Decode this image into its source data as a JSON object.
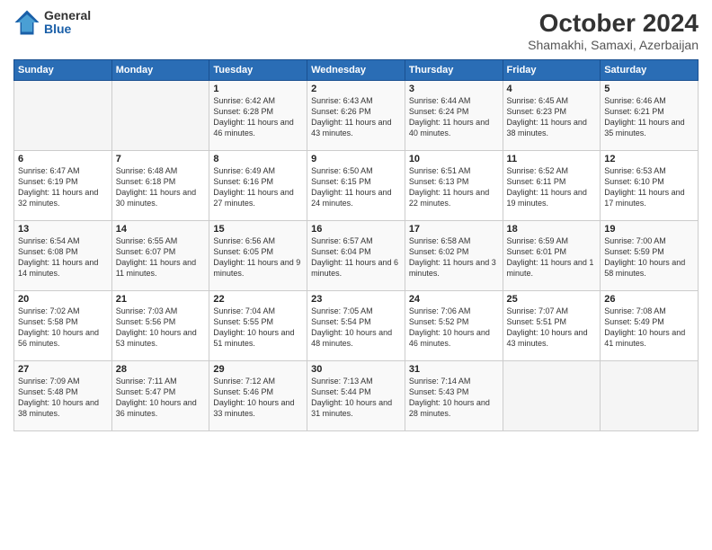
{
  "logo": {
    "general": "General",
    "blue": "Blue"
  },
  "header": {
    "month": "October 2024",
    "location": "Shamakhi, Samaxi, Azerbaijan"
  },
  "weekdays": [
    "Sunday",
    "Monday",
    "Tuesday",
    "Wednesday",
    "Thursday",
    "Friday",
    "Saturday"
  ],
  "weeks": [
    [
      {
        "day": "",
        "content": ""
      },
      {
        "day": "",
        "content": ""
      },
      {
        "day": "1",
        "content": "Sunrise: 6:42 AM\nSunset: 6:28 PM\nDaylight: 11 hours and 46 minutes."
      },
      {
        "day": "2",
        "content": "Sunrise: 6:43 AM\nSunset: 6:26 PM\nDaylight: 11 hours and 43 minutes."
      },
      {
        "day": "3",
        "content": "Sunrise: 6:44 AM\nSunset: 6:24 PM\nDaylight: 11 hours and 40 minutes."
      },
      {
        "day": "4",
        "content": "Sunrise: 6:45 AM\nSunset: 6:23 PM\nDaylight: 11 hours and 38 minutes."
      },
      {
        "day": "5",
        "content": "Sunrise: 6:46 AM\nSunset: 6:21 PM\nDaylight: 11 hours and 35 minutes."
      }
    ],
    [
      {
        "day": "6",
        "content": "Sunrise: 6:47 AM\nSunset: 6:19 PM\nDaylight: 11 hours and 32 minutes."
      },
      {
        "day": "7",
        "content": "Sunrise: 6:48 AM\nSunset: 6:18 PM\nDaylight: 11 hours and 30 minutes."
      },
      {
        "day": "8",
        "content": "Sunrise: 6:49 AM\nSunset: 6:16 PM\nDaylight: 11 hours and 27 minutes."
      },
      {
        "day": "9",
        "content": "Sunrise: 6:50 AM\nSunset: 6:15 PM\nDaylight: 11 hours and 24 minutes."
      },
      {
        "day": "10",
        "content": "Sunrise: 6:51 AM\nSunset: 6:13 PM\nDaylight: 11 hours and 22 minutes."
      },
      {
        "day": "11",
        "content": "Sunrise: 6:52 AM\nSunset: 6:11 PM\nDaylight: 11 hours and 19 minutes."
      },
      {
        "day": "12",
        "content": "Sunrise: 6:53 AM\nSunset: 6:10 PM\nDaylight: 11 hours and 17 minutes."
      }
    ],
    [
      {
        "day": "13",
        "content": "Sunrise: 6:54 AM\nSunset: 6:08 PM\nDaylight: 11 hours and 14 minutes."
      },
      {
        "day": "14",
        "content": "Sunrise: 6:55 AM\nSunset: 6:07 PM\nDaylight: 11 hours and 11 minutes."
      },
      {
        "day": "15",
        "content": "Sunrise: 6:56 AM\nSunset: 6:05 PM\nDaylight: 11 hours and 9 minutes."
      },
      {
        "day": "16",
        "content": "Sunrise: 6:57 AM\nSunset: 6:04 PM\nDaylight: 11 hours and 6 minutes."
      },
      {
        "day": "17",
        "content": "Sunrise: 6:58 AM\nSunset: 6:02 PM\nDaylight: 11 hours and 3 minutes."
      },
      {
        "day": "18",
        "content": "Sunrise: 6:59 AM\nSunset: 6:01 PM\nDaylight: 11 hours and 1 minute."
      },
      {
        "day": "19",
        "content": "Sunrise: 7:00 AM\nSunset: 5:59 PM\nDaylight: 10 hours and 58 minutes."
      }
    ],
    [
      {
        "day": "20",
        "content": "Sunrise: 7:02 AM\nSunset: 5:58 PM\nDaylight: 10 hours and 56 minutes."
      },
      {
        "day": "21",
        "content": "Sunrise: 7:03 AM\nSunset: 5:56 PM\nDaylight: 10 hours and 53 minutes."
      },
      {
        "day": "22",
        "content": "Sunrise: 7:04 AM\nSunset: 5:55 PM\nDaylight: 10 hours and 51 minutes."
      },
      {
        "day": "23",
        "content": "Sunrise: 7:05 AM\nSunset: 5:54 PM\nDaylight: 10 hours and 48 minutes."
      },
      {
        "day": "24",
        "content": "Sunrise: 7:06 AM\nSunset: 5:52 PM\nDaylight: 10 hours and 46 minutes."
      },
      {
        "day": "25",
        "content": "Sunrise: 7:07 AM\nSunset: 5:51 PM\nDaylight: 10 hours and 43 minutes."
      },
      {
        "day": "26",
        "content": "Sunrise: 7:08 AM\nSunset: 5:49 PM\nDaylight: 10 hours and 41 minutes."
      }
    ],
    [
      {
        "day": "27",
        "content": "Sunrise: 7:09 AM\nSunset: 5:48 PM\nDaylight: 10 hours and 38 minutes."
      },
      {
        "day": "28",
        "content": "Sunrise: 7:11 AM\nSunset: 5:47 PM\nDaylight: 10 hours and 36 minutes."
      },
      {
        "day": "29",
        "content": "Sunrise: 7:12 AM\nSunset: 5:46 PM\nDaylight: 10 hours and 33 minutes."
      },
      {
        "day": "30",
        "content": "Sunrise: 7:13 AM\nSunset: 5:44 PM\nDaylight: 10 hours and 31 minutes."
      },
      {
        "day": "31",
        "content": "Sunrise: 7:14 AM\nSunset: 5:43 PM\nDaylight: 10 hours and 28 minutes."
      },
      {
        "day": "",
        "content": ""
      },
      {
        "day": "",
        "content": ""
      }
    ]
  ]
}
